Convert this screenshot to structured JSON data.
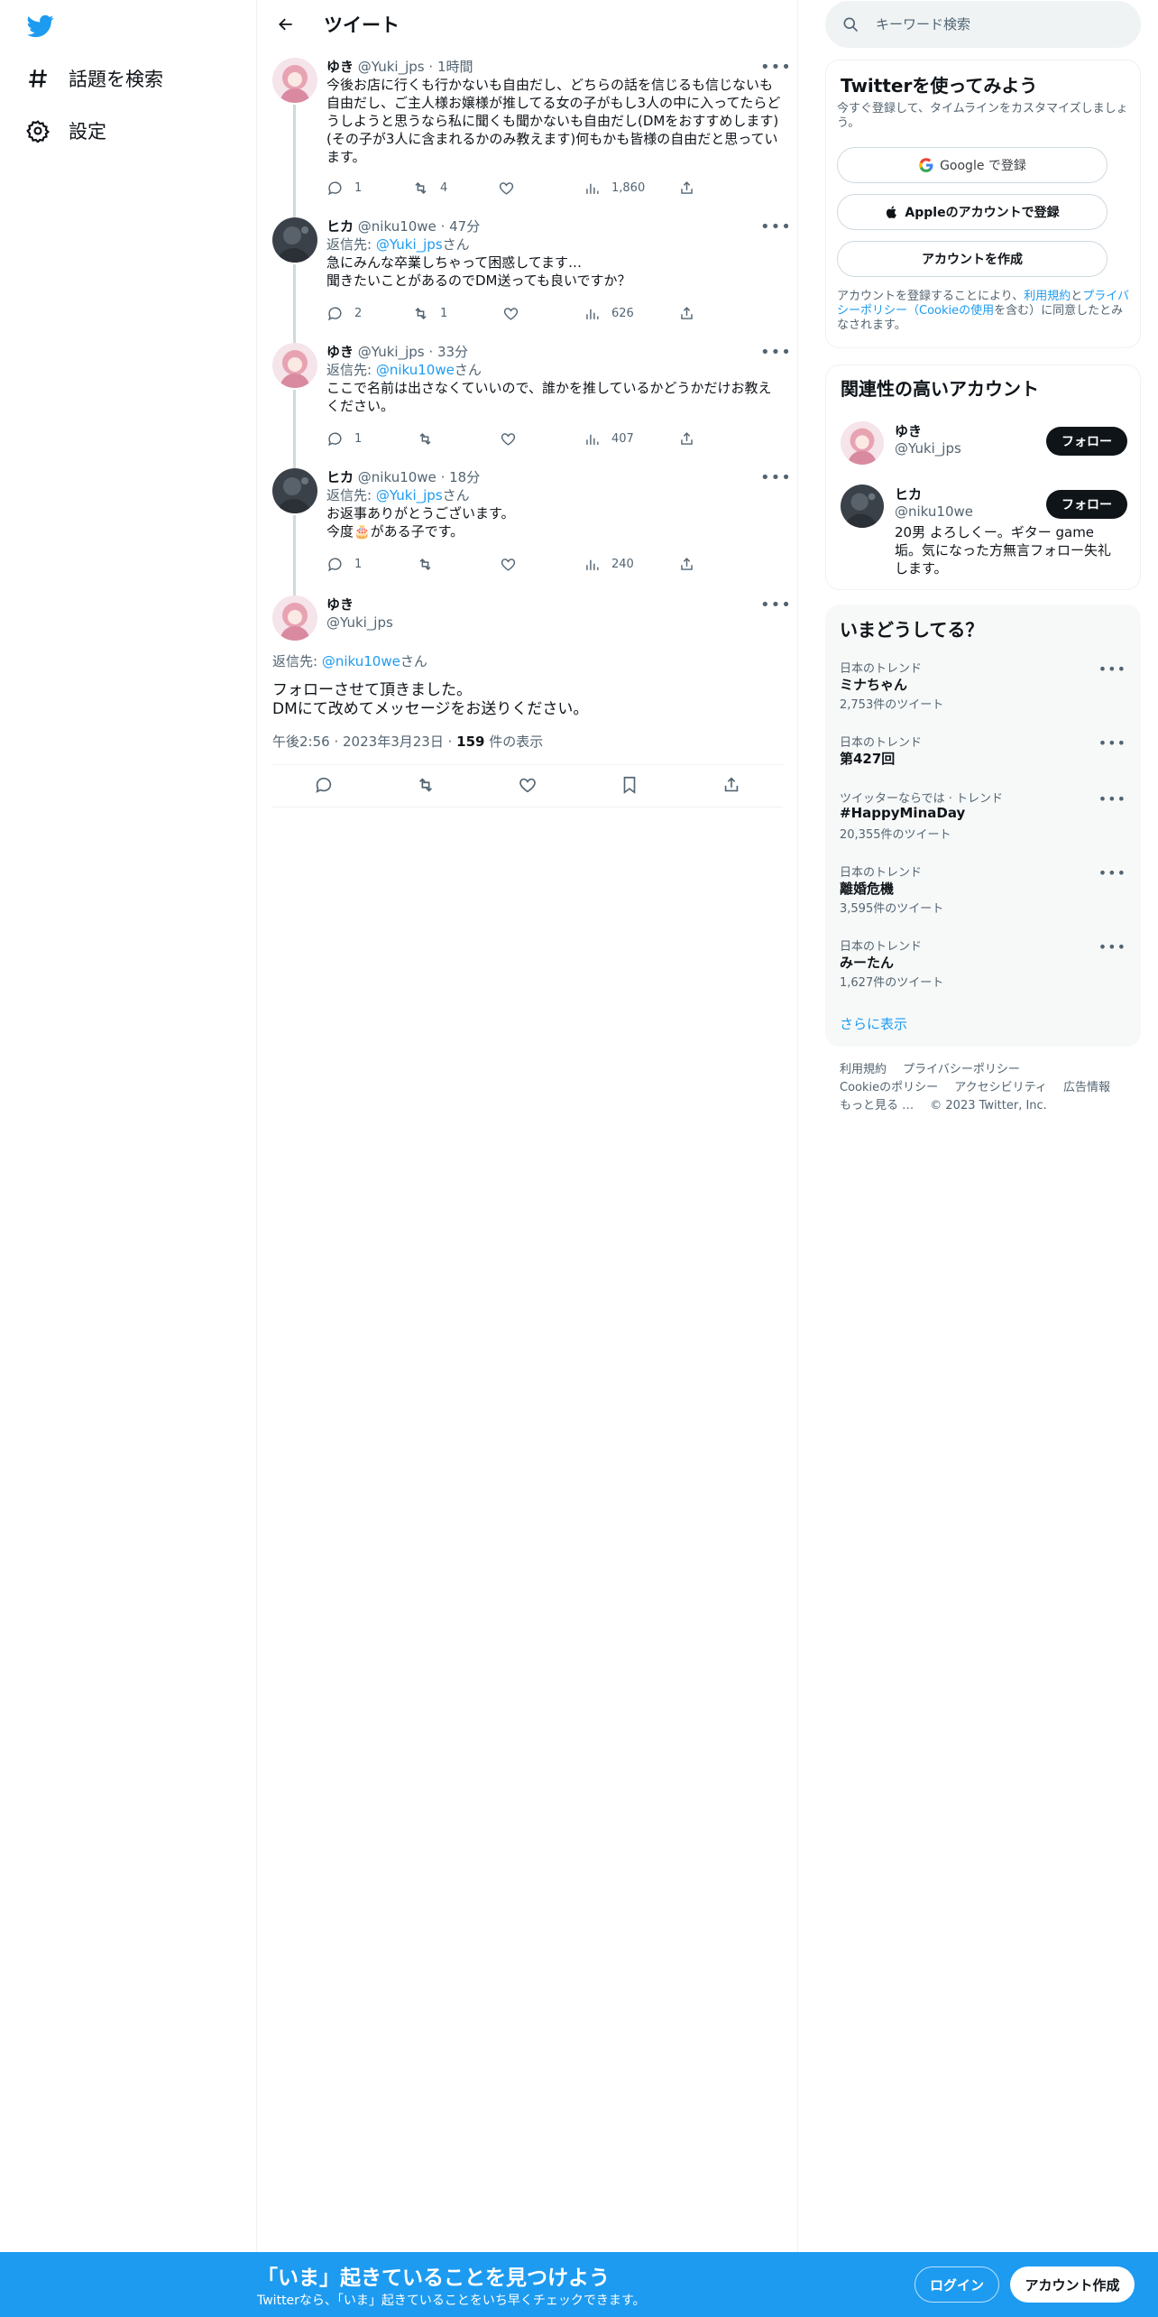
{
  "nav": {
    "logo": "twitter-bird-icon",
    "items": [
      {
        "label": "話題を検索",
        "icon": "hashtag-icon"
      },
      {
        "label": "設定",
        "icon": "gear-icon"
      }
    ]
  },
  "header": {
    "title": "ツイート"
  },
  "tweets": [
    {
      "name": "ゆき",
      "handle": "@Yuki_jps",
      "time": "1時間",
      "reply_to": "",
      "text_lines": [
        "今後お店に行くも行かないも自由だし、どちらの話を信じるも信じないも",
        "自由だし、ご主人様お嬢様が推してる女の子がもし3人の中に入ってたらど",
        "うしようと思うなら私に聞くも聞かないも自由だし(DMをおすすめします)",
        "(その子が3人に含まれるかのみ教えます)何もかも皆様の自由だと思ってい",
        "ます。"
      ],
      "replies": "1",
      "retweets": "4",
      "likes": "",
      "views": "1,860"
    },
    {
      "name": "ヒカ",
      "handle": "@niku10we",
      "time": "47分",
      "reply_to": "@Yuki_jps",
      "text_lines": [
        "急にみんな卒業しちゃって困惑してます…",
        "聞きたいことがあるのでDM送っても良いですか？"
      ],
      "replies": "2",
      "retweets": "1",
      "likes": "",
      "views": "626"
    },
    {
      "name": "ゆき",
      "handle": "@Yuki_jps",
      "time": "33分",
      "reply_to": "@niku10we",
      "text_lines": [
        "ここで名前は出さなくていいので、誰かを推しているかどうかだけお教え",
        "ください。"
      ],
      "replies": "1",
      "retweets": "",
      "likes": "",
      "views": "407"
    },
    {
      "name": "ヒカ",
      "handle": "@niku10we",
      "time": "18分",
      "reply_to": "@Yuki_jps",
      "text_lines": [
        "お返事ありがとうございます。",
        "今度🎂がある子です。"
      ],
      "replies": "1",
      "retweets": "",
      "likes": "",
      "views": "240"
    }
  ],
  "reply_prefix": "返信先: ",
  "reply_suffix": "さん",
  "focused": {
    "name": "ゆき",
    "handle": "@Yuki_jps",
    "reply_to": "@niku10we",
    "text_lines": [
      "フォローさせて頂きました。",
      "DMにて改めてメッセージをお送りください。"
    ],
    "time": "午後2:56",
    "date": "2023年3月23日",
    "views_count": "159",
    "views_label": " 件の表示"
  },
  "search": {
    "placeholder": "キーワード検索"
  },
  "signup": {
    "title": "Twitterを使ってみよう",
    "subtitle": "今すぐ登録して、タイムラインをカスタマイズしましょう。",
    "google_label": "Google で登録",
    "apple_label": "Appleのアカウントで登録",
    "create_label": "アカウントを作成",
    "legal_pre": "アカウントを登録することにより、",
    "legal_terms": "利用規約",
    "legal_and": "と",
    "legal_privacy": "プライバシーポリシー",
    "legal_cookie": "（Cookieの使用",
    "legal_post": "を含む）に同意したとみなされます。"
  },
  "related": {
    "title": "関連性の高いアカウント",
    "follow_label": "フォロー",
    "accounts": [
      {
        "name": "ゆき",
        "handle": "@Yuki_jps",
        "bio": ""
      },
      {
        "name": "ヒカ",
        "handle": "@niku10we",
        "bio": "20男 よろしくー。ギター game垢。気になった方無言フォロー失礼します。"
      }
    ]
  },
  "trends": {
    "title": "いまどうしてる？",
    "items": [
      {
        "context": "日本のトレンド",
        "name": "ミナちゃん",
        "count": "2,753件のツイート"
      },
      {
        "context": "日本のトレンド",
        "name": "第427回",
        "count": ""
      },
      {
        "context": "ツイッターならでは · トレンド",
        "name": "#HappyMinaDay",
        "count": "20,355件のツイート"
      },
      {
        "context": "日本のトレンド",
        "name": "離婚危機",
        "count": "3,595件のツイート"
      },
      {
        "context": "日本のトレンド",
        "name": "みーたん",
        "count": "1,627件のツイート"
      }
    ],
    "show_more": "さらに表示"
  },
  "footer": {
    "links": [
      "利用規約",
      "プライバシーポリシー",
      "Cookieのポリシー",
      "アクセシビリティ",
      "広告情報",
      "もっと見る …",
      "© 2023 Twitter, Inc."
    ]
  },
  "banner": {
    "title": "「いま」起きていることを見つけよう",
    "subtitle": "Twitterなら、「いま」起きていることをいち早くチェックできます。",
    "login_label": "ログイン",
    "signup_label": "アカウント作成"
  },
  "colors": {
    "accent": "#1d9bf0",
    "text": "#0f1419",
    "muted": "#536471",
    "avatar_pink": "#e8a3b3",
    "avatar_dark": "#3b4148"
  }
}
